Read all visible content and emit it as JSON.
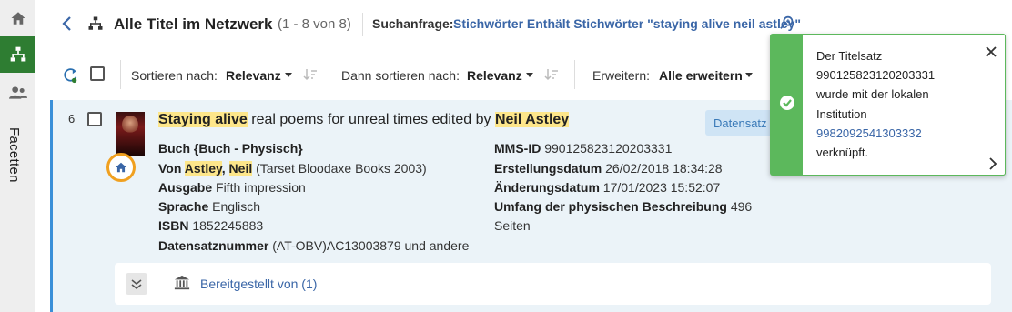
{
  "rail": {
    "facets_label": "Facetten"
  },
  "header": {
    "title": "Alle Titel im Netzwerk",
    "count": "(1 - 8 von 8)",
    "query_label": "Suchanfrage:",
    "query_value": "Stichwörter Enthält Stichwörter \"staying alive neil astley\""
  },
  "toolbar": {
    "sort_label": "Sortieren nach:",
    "sort_value": "Relevanz",
    "then_sort_label": "Dann sortieren nach:",
    "then_sort_value": "Relevanz",
    "expand_label": "Erweitern:",
    "expand_value": "Alle erweitern"
  },
  "record": {
    "number": "6",
    "title_hl1": "Staying alive",
    "title_mid": " real poems for unreal times edited by ",
    "title_hl2": "Neil Astley",
    "badge": "Datensatz",
    "type": "Buch {Buch - Physisch}",
    "author_prefix": "Von ",
    "author_last": "Astley",
    "author_sep": ", ",
    "author_first": "Neil",
    "author_rest": " (Tarset Bloodaxe Books 2003)",
    "edition_label": "Ausgabe",
    "edition_value": "Fifth impression",
    "language_label": "Sprache",
    "language_value": "Englisch",
    "isbn_label": "ISBN",
    "isbn_value": "1852245883",
    "recnum_label": "Datensatznummer",
    "recnum_value": "(AT-OBV)AC13003879 und andere",
    "mms_label": "MMS-ID",
    "mms_value": "990125823120203331",
    "created_label": "Erstellungsdatum",
    "created_value": "26/02/2018 18:34:28",
    "modified_label": "Änderungsdatum",
    "modified_value": "17/01/2023 15:52:07",
    "extent_label": "Umfang der physischen Beschreibung",
    "extent_value": "496",
    "extent_unit": "Seiten",
    "availability_link": "Bereitgestellt von (1)"
  },
  "toast": {
    "line1": "Der Titelsatz",
    "line2": "990125823120203331",
    "line3": "wurde mit der lokalen",
    "line4": "Institution",
    "link": "9982092541303332",
    "line6": "verknüpft."
  },
  "colors": {
    "accent_green": "#2e7d32",
    "toast_green": "#5cb85c",
    "link_blue": "#3a66a7",
    "highlight": "#fde68a",
    "record_bg": "#ebf3f8"
  }
}
